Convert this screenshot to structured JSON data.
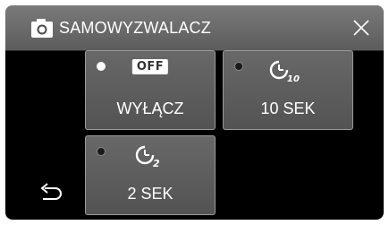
{
  "header": {
    "title": "SAMOWYZWALACZ",
    "title_icon": "camera-icon",
    "close_icon": "close-icon"
  },
  "options": [
    {
      "label": "WYŁĄCZ",
      "badge": "OFF",
      "icon": "off-icon",
      "selected": true
    },
    {
      "label": "10 SEK",
      "icon": "self-timer-10-icon",
      "timer_digits": "10",
      "selected": false
    },
    {
      "label": "2 SEK",
      "icon": "self-timer-2-icon",
      "timer_digits": "2",
      "selected": false
    }
  ],
  "footer": {
    "back_icon": "back-arrow-icon"
  },
  "colors": {
    "panel": "#000000",
    "header": "#6a6a6a",
    "tile": "#5e5e5e",
    "text": "#ffffff"
  }
}
